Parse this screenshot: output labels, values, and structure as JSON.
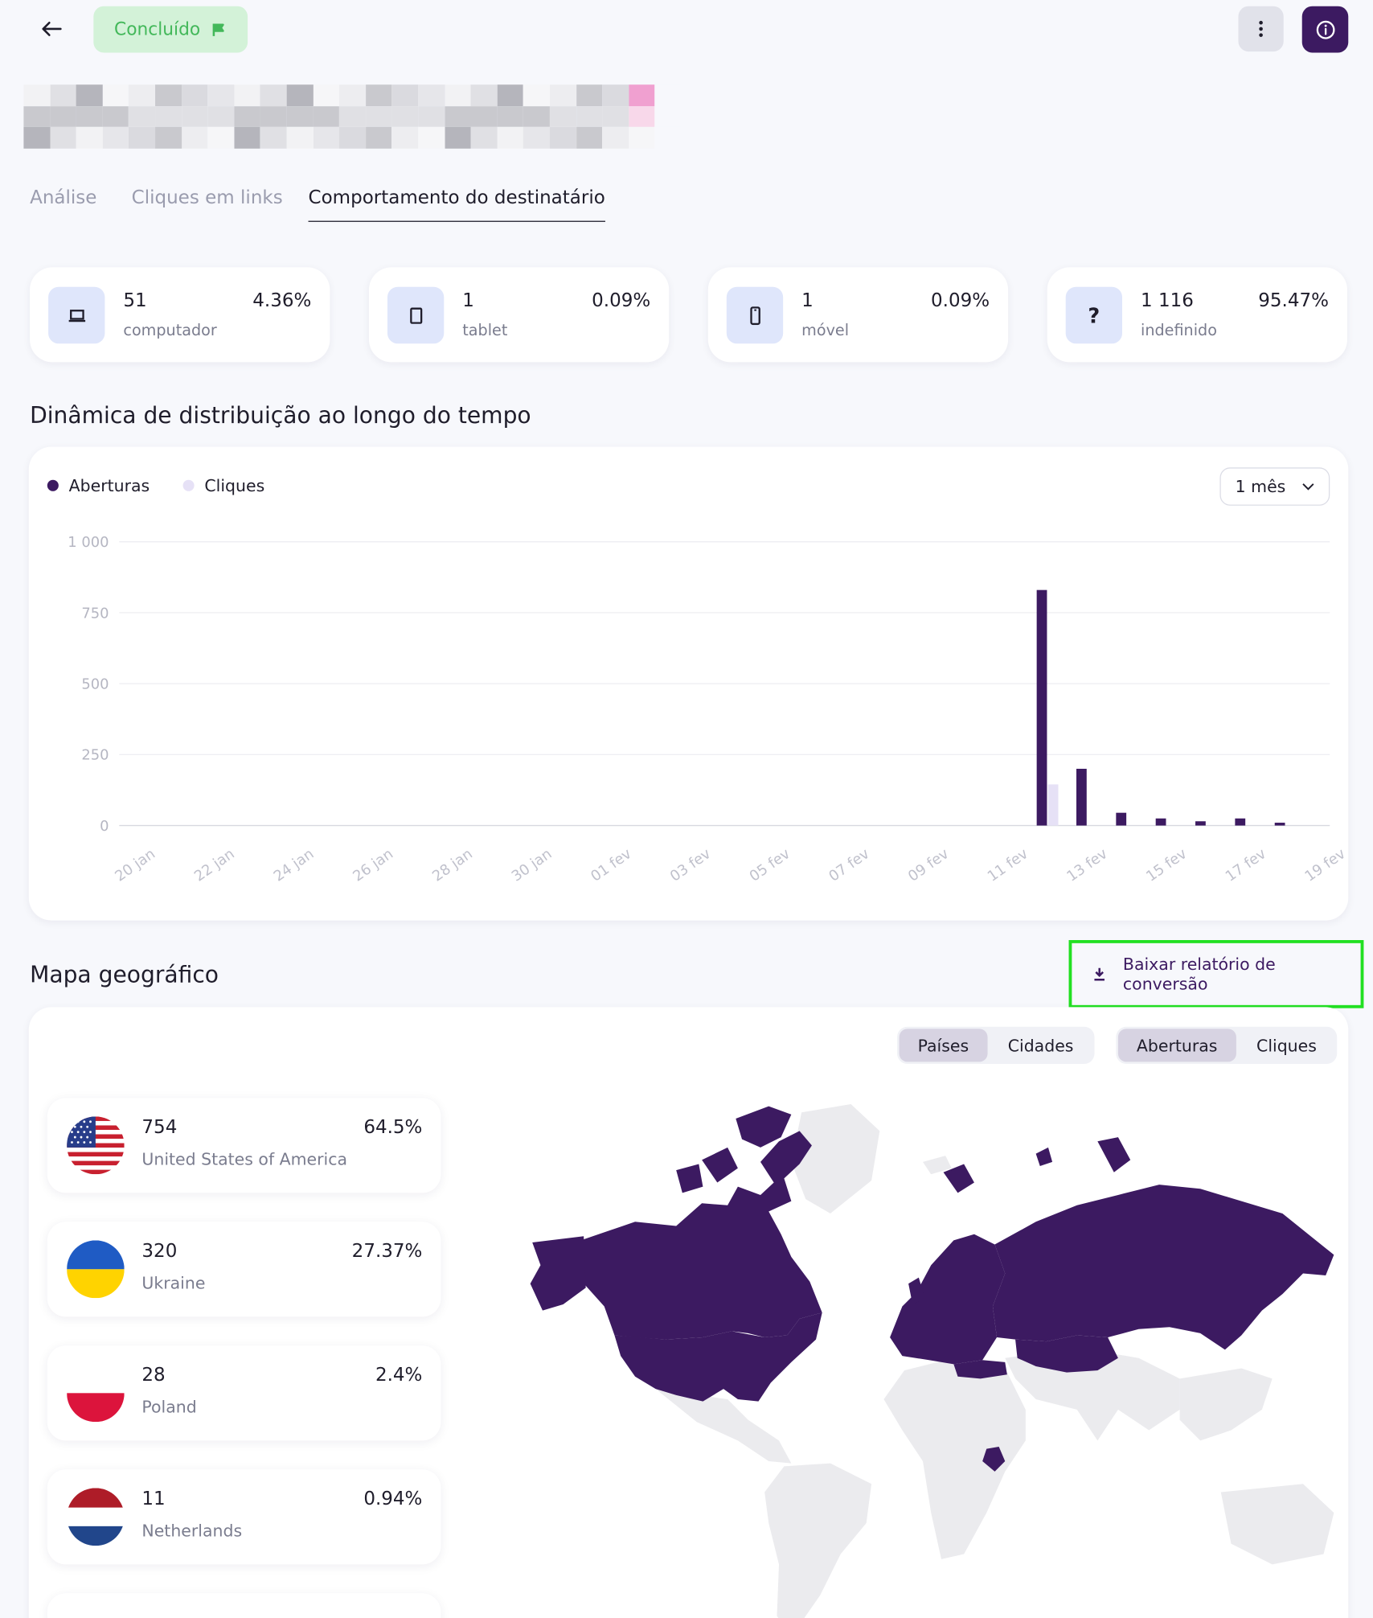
{
  "header": {
    "status_label": "Concluído",
    "status_color": "#43b85a",
    "accent_color": "#3c1a61"
  },
  "tabs": [
    {
      "label": "Análise",
      "active": false
    },
    {
      "label": "Cliques em links",
      "active": false
    },
    {
      "label": "Comportamento do destinatário",
      "active": true
    }
  ],
  "devices": [
    {
      "count": "51",
      "label": "computador",
      "percent": "4.36%",
      "icon": "laptop-icon"
    },
    {
      "count": "1",
      "label": "tablet",
      "percent": "0.09%",
      "icon": "tablet-icon"
    },
    {
      "count": "1",
      "label": "móvel",
      "percent": "0.09%",
      "icon": "mobile-icon"
    },
    {
      "count": "1 116",
      "label": "indefinido",
      "percent": "95.47%",
      "icon": "question-icon"
    }
  ],
  "distribution": {
    "title": "Dinâmica de distribuição ao longo do tempo",
    "period_label": "1 mês"
  },
  "chart_data": {
    "type": "bar",
    "categories": [
      "20 jan",
      "21 jan",
      "22 jan",
      "23 jan",
      "24 jan",
      "25 jan",
      "26 jan",
      "27 jan",
      "28 jan",
      "29 jan",
      "30 jan",
      "31 jan",
      "01 fev",
      "02 fev",
      "03 fev",
      "04 fev",
      "05 fev",
      "06 fev",
      "07 fev",
      "08 fev",
      "09 fev",
      "10 fev",
      "11 fev",
      "12 fev",
      "13 fev",
      "14 fev",
      "15 fev",
      "16 fev",
      "17 fev",
      "18 fev",
      "19 fev"
    ],
    "tick_labels": [
      "20 jan",
      "22 jan",
      "24 jan",
      "26 jan",
      "28 jan",
      "30 jan",
      "01 fev",
      "03 fev",
      "05 fev",
      "07 fev",
      "09 fev",
      "11 fev",
      "13 fev",
      "15 fev",
      "17 fev",
      "19 fev"
    ],
    "series": [
      {
        "name": "Aberturas",
        "color": "#3c1a61",
        "values": [
          0,
          0,
          0,
          0,
          0,
          0,
          0,
          0,
          0,
          0,
          0,
          0,
          0,
          0,
          0,
          0,
          0,
          0,
          0,
          0,
          0,
          0,
          0,
          830,
          200,
          45,
          25,
          15,
          25,
          10,
          0
        ]
      },
      {
        "name": "Cliques",
        "color": "#e6e1f6",
        "values": [
          0,
          0,
          0,
          0,
          0,
          0,
          0,
          0,
          0,
          0,
          0,
          0,
          0,
          0,
          0,
          0,
          0,
          0,
          0,
          0,
          0,
          0,
          0,
          145,
          0,
          0,
          0,
          0,
          0,
          0,
          0
        ]
      }
    ],
    "y_ticks": [
      "0",
      "250",
      "500",
      "750",
      "1 000"
    ],
    "ylim": [
      0,
      1000
    ],
    "grid": true,
    "legend": "top-left"
  },
  "geo": {
    "title": "Mapa geográfico",
    "download_label": "Baixar relatório de conversão",
    "scope_toggle": [
      "Países",
      "Cidades"
    ],
    "metric_toggle": [
      "Aberturas",
      "Cliques"
    ],
    "countries": [
      {
        "count": "754",
        "name": "United States of America",
        "percent": "64.5%",
        "flag": "usa-flag-icon"
      },
      {
        "count": "320",
        "name": "Ukraine",
        "percent": "27.37%",
        "flag": "ukraine-flag-icon"
      },
      {
        "count": "28",
        "name": "Poland",
        "percent": "2.4%",
        "flag": "poland-flag-icon"
      },
      {
        "count": "11",
        "name": "Netherlands",
        "percent": "0.94%",
        "flag": "netherlands-flag-icon"
      }
    ]
  }
}
